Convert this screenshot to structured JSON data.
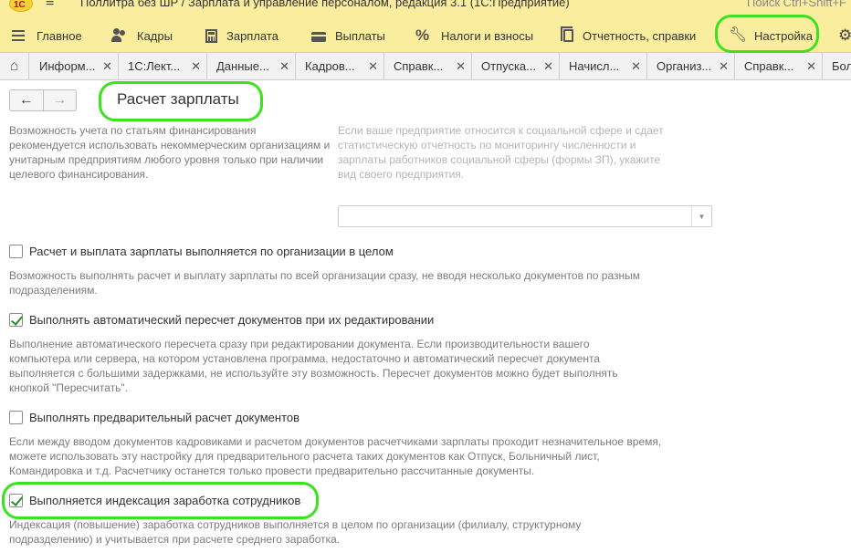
{
  "titlebar": {
    "logo": "1С",
    "title": "Поллитра без ШР / Зарплата и управление персоналом, редакция 3.1  (1С:Предприятие)",
    "search_hint": "Поиск Ctrl+Shift+F"
  },
  "menu": [
    {
      "label": "Главное",
      "icon": "menu-lines-icon"
    },
    {
      "label": "Кадры",
      "icon": "people-icon"
    },
    {
      "label": "Зарплата",
      "icon": "calculator-icon"
    },
    {
      "label": "Выплаты",
      "icon": "wallet-icon"
    },
    {
      "label": "Налоги и взносы",
      "icon": "percent-icon"
    },
    {
      "label": "Отчетность, справки",
      "icon": "documents-icon"
    },
    {
      "label": "Настройка",
      "icon": "wrench-icon"
    }
  ],
  "tabs": [
    {
      "label": "Информ..."
    },
    {
      "label": "1С:Лект..."
    },
    {
      "label": "Данные..."
    },
    {
      "label": "Кадров..."
    },
    {
      "label": "Справк..."
    },
    {
      "label": "Отпуска..."
    },
    {
      "label": "Начисл..."
    },
    {
      "label": "Организ..."
    },
    {
      "label": "Справк..."
    },
    {
      "label": "Бол"
    }
  ],
  "form": {
    "title": "Расчет зарплаты",
    "financing_hint": "Возможность учета по статьям финансирования рекомендуется использовать некоммерческим организациям и унитарным предприятиям любого уровня только при наличии целевого финансирования.",
    "social_hint": "Если ваше предприятие относится к социальной сфере и сдает статистическую отчетность по мониторингу численности и зарплаты работников социальной сферы (формы ЗП), укажите вид своего предприятия.",
    "social_select_value": "",
    "options": [
      {
        "label": "Расчет и выплата зарплаты выполняется по организации в целом",
        "checked": false,
        "hint": "Возможность выполнять расчет и выплату зарплаты по всей организации сразу, не вводя несколько документов по разным подразделениям."
      },
      {
        "label": "Выполнять автоматический пересчет документов при их редактировании",
        "checked": true,
        "hint": "Выполнение автоматического пересчета сразу при редактировании документа. Если производительности вашего компьютера или сервера, на котором установлена программа, недостаточно и автоматический пересчет документа выполняется с большими задержками, не используйте эту возможность. Пересчет документов можно будет выполнять кнопкой \"Пересчитать\"."
      },
      {
        "label": "Выполнять предварительный расчет документов",
        "checked": false,
        "hint": "Если между вводом документов кадровиками и расчетом документов расчетчиками зарплаты проходит незначительное время, можете использовать эту настройку для предварительного расчета таких документов как Отпуск, Больничный лист, Командировка и т.д. Расчетчику останется только провести предварительно рассчитанные документы."
      },
      {
        "label": "Выполняется индексация заработка сотрудников",
        "checked": true,
        "hint": "Индексация (повышение) заработка сотрудников выполняется в целом по организации (филиалу, структурному подразделению) и учитывается при расчете среднего заработка."
      }
    ]
  },
  "colors": {
    "section_bar": "#fbed9e",
    "annotation": "#3ce21f",
    "check": "#2c8c2c"
  }
}
